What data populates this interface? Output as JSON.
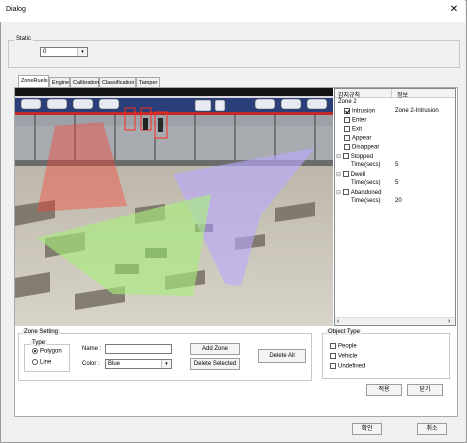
{
  "window": {
    "title": "Dialog"
  },
  "static_group": {
    "label": "Static",
    "combo_value": "0"
  },
  "tabs": [
    {
      "label": "ZoneRuels"
    },
    {
      "label": "Engine"
    },
    {
      "label": "Calibration"
    },
    {
      "label": "Classification"
    },
    {
      "label": "Tamper"
    }
  ],
  "tree": {
    "col_rule": "감지규칙",
    "col_info": "정보",
    "zone": "Zone 2",
    "rows": [
      {
        "label": "Intrusion",
        "checked": true,
        "info": "Zone 2-Intrusion"
      },
      {
        "label": "Enter"
      },
      {
        "label": "Exit"
      },
      {
        "label": "Appear"
      },
      {
        "label": "Disappear"
      },
      {
        "label": "Stopped",
        "expandable": true
      },
      {
        "label": "Time(secs)",
        "info": "5",
        "child": true
      },
      {
        "label": "Dwell",
        "expandable": true
      },
      {
        "label": "Time(secs)",
        "info": "5",
        "child": true
      },
      {
        "label": "Abandoned",
        "expandable": true
      },
      {
        "label": "Time(secs)",
        "info": "20",
        "child": true
      }
    ],
    "expand_glyph": "⊟",
    "scroll_left": "‹",
    "scroll_right": "›"
  },
  "zone_setting": {
    "label": "Zone Setting",
    "type_label": "Type",
    "polygon": "Polygon",
    "line": "Line",
    "name_label": "Name :",
    "name_value": "",
    "color_label": "Color :",
    "color_value": "Blue",
    "add_zone": "Add Zone",
    "delete_selected": "Delete Selected",
    "delete_all": "Delete All"
  },
  "object_type": {
    "label": "Object Type",
    "people": "People",
    "vehicle": "Vehicle",
    "undefined": "Undefined"
  },
  "buttons": {
    "apply": "적용",
    "close_tab": "닫기",
    "ok": "확인",
    "cancel": "취소"
  },
  "icons": {
    "close": "✕",
    "dropdown": "▾"
  },
  "colors": {
    "zone_green": "#a8f07a",
    "zone_purple": "#b9a9ff",
    "zone_red": "#ff3a2a",
    "train_blue": "#2a3f7a"
  }
}
